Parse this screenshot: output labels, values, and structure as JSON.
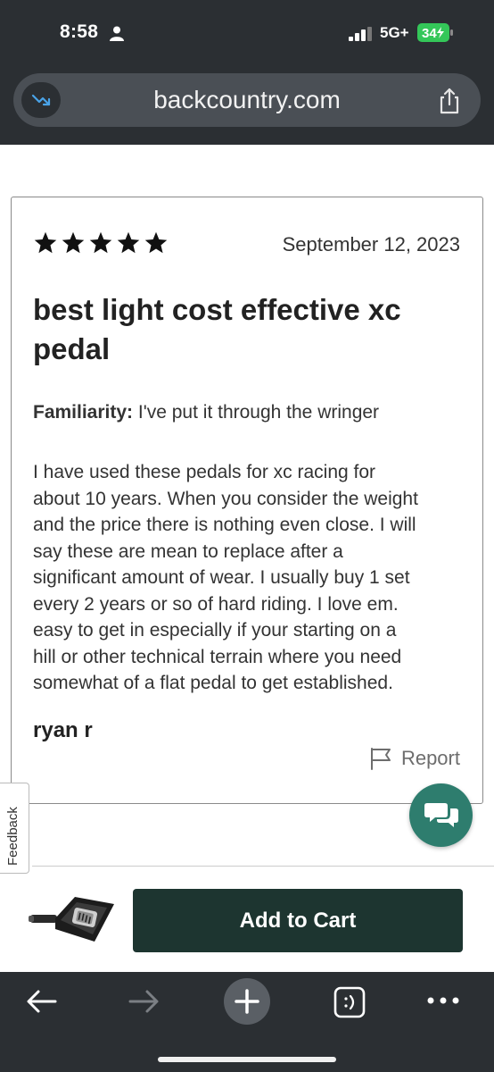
{
  "status_bar": {
    "time": "8:58",
    "network": "5G+",
    "battery": "34"
  },
  "browser": {
    "url": "backcountry.com"
  },
  "review": {
    "rating": 5,
    "date": "September 12, 2023",
    "title": "best light cost effective xc pedal",
    "familiarity_label": "Familiarity:",
    "familiarity_value": "I've put it through the wringer",
    "body_lines": [
      "I have used these pedals for xc racing for",
      "about 10 years. When you consider the weight",
      "and the price there is nothing even close. I will",
      "say these are mean to replace after a",
      "significant amount of wear. I usually buy 1 set",
      "every 2 years or so of hard riding. I love em.",
      "easy to get in especially if your starting on a",
      "hill or other technical terrain where you need",
      "somewhat of a flat pedal to get established."
    ],
    "author": "ryan r",
    "report_label": "Report"
  },
  "feedback_tab": {
    "label": "Feedback"
  },
  "cart": {
    "button_label": "Add to Cart"
  },
  "colors": {
    "topbar": "#2b2f33",
    "cart_button": "#1d3530",
    "chat_button": "#2e7d6e"
  }
}
